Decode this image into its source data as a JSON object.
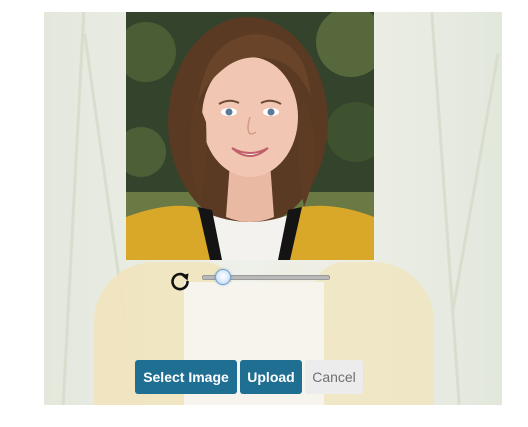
{
  "image_cropper": {
    "photo_alt": "Portrait photo of a smiling young woman",
    "rotate_icon": "rotate-clockwise-icon",
    "zoom_slider": {
      "value_fraction": 0.13,
      "accent_color": "#6fa3d8"
    }
  },
  "actions": {
    "select_image_label": "Select Image",
    "upload_label": "Upload",
    "cancel_label": "Cancel",
    "primary_color": "#1f6f93",
    "secondary_color": "#ececec"
  }
}
